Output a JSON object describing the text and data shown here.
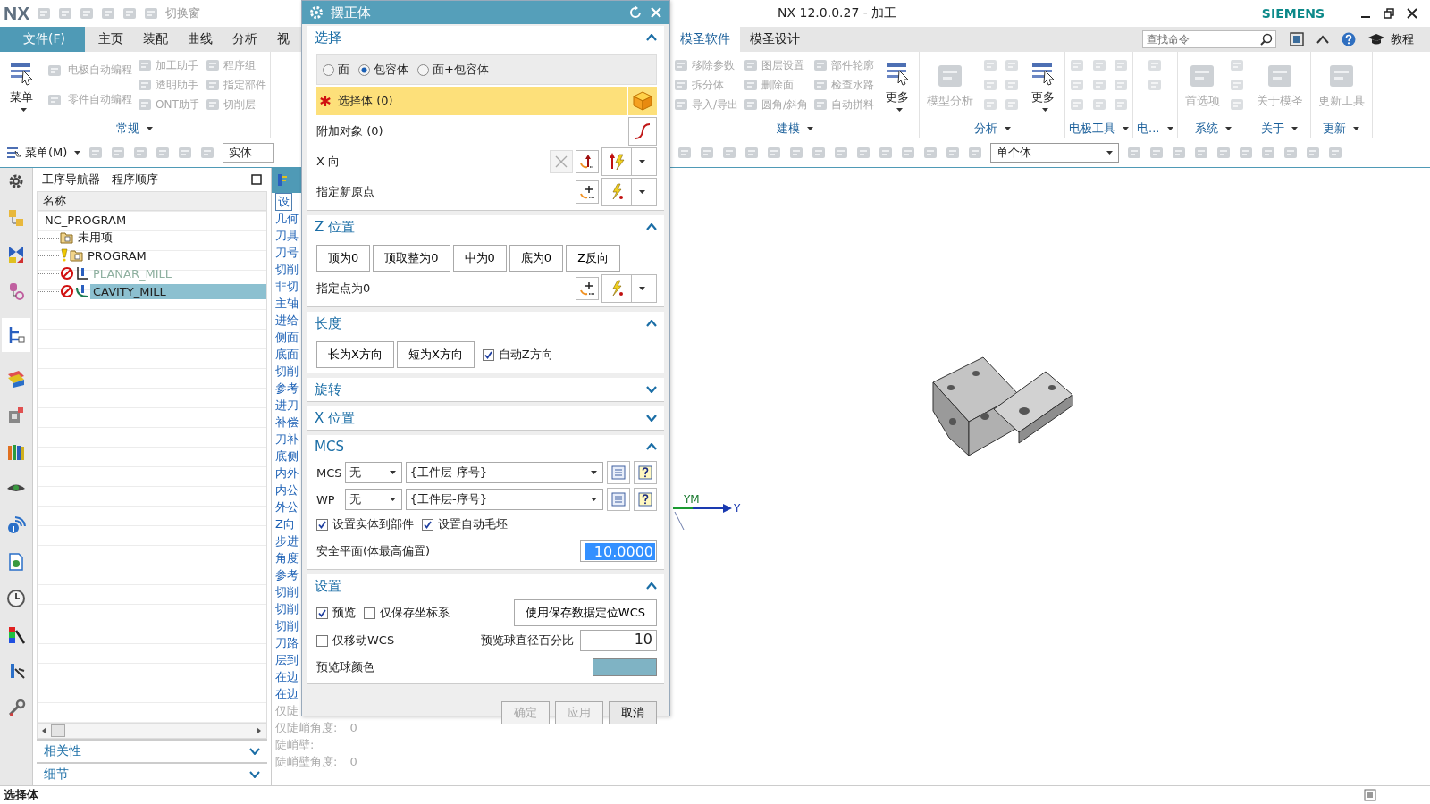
{
  "titlebar": {
    "logo": "NX",
    "switch_window": "切换窗",
    "title": "NX 12.0.0.27 - 加工",
    "brand": "SIEMENS"
  },
  "tabs_left": [
    {
      "label": "文件(F)",
      "kind": "file",
      "selected": false
    },
    {
      "label": "主页",
      "kind": "tab",
      "selected": false
    },
    {
      "label": "装配",
      "kind": "tab",
      "selected": false
    },
    {
      "label": "曲线",
      "kind": "tab",
      "selected": false
    },
    {
      "label": "分析",
      "kind": "tab",
      "selected": false
    },
    {
      "label": "视",
      "kind": "tab",
      "selected": false
    }
  ],
  "tabs_right": [
    {
      "label": "模圣软件",
      "selected": true
    },
    {
      "label": "模圣设计",
      "selected": false
    }
  ],
  "search": {
    "placeholder": "查找命令"
  },
  "help_label": "教程",
  "ribbon_left": [
    {
      "label": "常规",
      "items": [
        {
          "label": "菜单",
          "kind": "large",
          "disabled": false,
          "menu": true
        },
        {
          "label": "电极自动编程",
          "kind": "medium",
          "disabled": true
        },
        {
          "label": "零件自动编程",
          "kind": "medium",
          "disabled": true
        },
        {
          "label": "加工助手",
          "kind": "small",
          "disabled": true
        },
        {
          "label": "透明助手",
          "kind": "small",
          "disabled": true
        },
        {
          "label": "ONT助手",
          "kind": "small",
          "disabled": true
        },
        {
          "label": "程序组",
          "kind": "small",
          "disabled": true
        },
        {
          "label": "指定部件",
          "kind": "small",
          "disabled": true
        },
        {
          "label": "切削层",
          "kind": "small",
          "disabled": true
        }
      ]
    }
  ],
  "ribbon_right": [
    {
      "label": "建模",
      "items": [
        {
          "label": "移除参数",
          "kind": "small",
          "disabled": true
        },
        {
          "label": "拆分体",
          "kind": "small",
          "disabled": true
        },
        {
          "label": "导入/导出",
          "kind": "small",
          "disabled": true
        },
        {
          "label": "图层设置",
          "kind": "small",
          "disabled": true
        },
        {
          "label": "删除面",
          "kind": "small",
          "disabled": true
        },
        {
          "label": "圆角/斜角",
          "kind": "small",
          "disabled": true
        },
        {
          "label": "部件轮廓",
          "kind": "small",
          "disabled": true
        },
        {
          "label": "检查水路",
          "kind": "small",
          "disabled": true
        },
        {
          "label": "自动拼料",
          "kind": "small",
          "disabled": true
        },
        {
          "label": "更多",
          "kind": "large",
          "disabled": false,
          "menu": true
        }
      ]
    },
    {
      "label": "分析",
      "items": [
        {
          "label": "模型分析",
          "kind": "large",
          "disabled": true
        },
        {
          "kind": "icon",
          "disabled": true
        },
        {
          "kind": "icon",
          "disabled": true
        },
        {
          "kind": "icon",
          "disabled": true
        },
        {
          "kind": "icon",
          "disabled": true
        },
        {
          "kind": "icon",
          "disabled": true
        },
        {
          "kind": "icon",
          "disabled": true
        },
        {
          "label": "更多",
          "kind": "large",
          "disabled": false,
          "menu": true
        }
      ]
    },
    {
      "label": "电极工具",
      "items": [
        {
          "kind": "icon",
          "disabled": true
        },
        {
          "kind": "icon",
          "disabled": true
        },
        {
          "kind": "icon",
          "disabled": true
        },
        {
          "kind": "icon",
          "disabled": true
        },
        {
          "kind": "icon",
          "disabled": true
        },
        {
          "kind": "icon",
          "disabled": true
        },
        {
          "kind": "icon",
          "disabled": true
        },
        {
          "kind": "icon",
          "disabled": true
        },
        {
          "kind": "icon",
          "disabled": true
        }
      ]
    },
    {
      "label": "电...",
      "items": [
        {
          "kind": "icon",
          "disabled": true
        },
        {
          "kind": "icon",
          "disabled": true
        }
      ]
    },
    {
      "label": "系统",
      "items": [
        {
          "label": "首选项",
          "kind": "large",
          "disabled": true
        },
        {
          "kind": "icon",
          "disabled": true
        },
        {
          "kind": "icon",
          "disabled": true
        },
        {
          "kind": "icon",
          "disabled": true
        }
      ]
    },
    {
      "label": "关于",
      "items": [
        {
          "label": "关于模圣",
          "kind": "large",
          "disabled": true
        }
      ]
    },
    {
      "label": "更新",
      "items": [
        {
          "label": "更新工具",
          "kind": "large",
          "disabled": true
        }
      ]
    }
  ],
  "toolbar": {
    "menu": "菜单(M)",
    "filter": "实体",
    "scope": "单个体"
  },
  "navigator": {
    "title": "工序导航器 - 程序顺序",
    "column": "名称",
    "tree": [
      {
        "label": "NC_PROGRAM",
        "selected": false,
        "disabled": false,
        "children": [
          {
            "label": "未用项",
            "kind": "folder",
            "warning": false,
            "blocked": false,
            "selected": false,
            "disabled": false
          },
          {
            "label": "PROGRAM",
            "kind": "folder",
            "warning": true,
            "blocked": false,
            "selected": false,
            "disabled": false
          },
          {
            "label": "PLANAR_MILL",
            "kind": "planar",
            "warning": false,
            "blocked": true,
            "selected": false,
            "disabled": true
          },
          {
            "label": "CAVITY_MILL",
            "kind": "cavity",
            "warning": false,
            "blocked": true,
            "selected": true,
            "disabled": false
          }
        ]
      }
    ],
    "panels": [
      {
        "title": "相关性",
        "expanded": false
      },
      {
        "title": "细节",
        "expanded": false
      }
    ]
  },
  "operation_list": [
    {
      "label": "设",
      "kind": "header",
      "disabled": false
    },
    {
      "label": "几何",
      "disabled": false
    },
    {
      "label": "刀具",
      "disabled": false
    },
    {
      "label": "刀号",
      "disabled": false
    },
    {
      "label": "切削",
      "disabled": false
    },
    {
      "label": "非切",
      "disabled": false
    },
    {
      "label": "主轴",
      "disabled": false
    },
    {
      "label": "进给",
      "disabled": false
    },
    {
      "label": "侧面",
      "disabled": false
    },
    {
      "label": "底面",
      "disabled": false
    },
    {
      "label": "切削",
      "disabled": false
    },
    {
      "label": "参考",
      "disabled": false
    },
    {
      "label": "进刀",
      "disabled": false
    },
    {
      "label": "补偿",
      "disabled": false
    },
    {
      "label": "刀补",
      "disabled": false
    },
    {
      "label": "底侧",
      "disabled": false
    },
    {
      "label": "内外",
      "disabled": false
    },
    {
      "label": "内公",
      "disabled": false
    },
    {
      "label": "外公",
      "disabled": false
    },
    {
      "label": "Z向",
      "disabled": false
    },
    {
      "label": "步进",
      "disabled": false
    },
    {
      "label": "角度",
      "disabled": false
    },
    {
      "label": "参考",
      "disabled": false
    },
    {
      "label": "切削",
      "disabled": false
    },
    {
      "label": "切削",
      "disabled": false
    },
    {
      "label": "切削",
      "disabled": false
    },
    {
      "label": "刀路",
      "disabled": false
    },
    {
      "label": "层到",
      "disabled": false
    },
    {
      "label": "在边",
      "disabled": false
    },
    {
      "label": "在边",
      "disabled": false
    },
    {
      "label": "仅陡",
      "disabled": true
    },
    {
      "label": "仅陡峭角度:",
      "value": "0",
      "disabled": true
    },
    {
      "label": "陡峭壁:",
      "disabled": true
    },
    {
      "label": "陡峭壁角度:",
      "value": "0",
      "disabled": true
    }
  ],
  "graphics": {
    "axis_labels": [
      "YM",
      "Y"
    ]
  },
  "dialog": {
    "title": "摆正体",
    "sections": [
      {
        "kind": "selection",
        "title": "选择",
        "expanded": true,
        "radios": [
          {
            "label": "面",
            "selected": false
          },
          {
            "label": "包容体",
            "selected": true
          },
          {
            "label": "面+包容体",
            "selected": false
          }
        ],
        "select_body": "选择体 (0)",
        "additional": "附加对象 (0)",
        "x_direction": "X 向",
        "new_origin": "指定新原点"
      },
      {
        "kind": "z_position",
        "title": "Z 位置",
        "expanded": true,
        "buttons": [
          "顶为0",
          "顶取整为0",
          "中为0",
          "底为0",
          "Z反向"
        ],
        "point": "指定点为0"
      },
      {
        "kind": "length",
        "title": "长度",
        "expanded": true,
        "buttons": [
          "长为X方向",
          "短为X方向"
        ],
        "checkbox": {
          "label": "自动Z方向",
          "checked": true
        }
      },
      {
        "title": "旋转",
        "expanded": false
      },
      {
        "title": "X 位置",
        "expanded": false
      },
      {
        "kind": "mcs",
        "title": "MCS",
        "expanded": true,
        "rows": [
          {
            "label": "MCS",
            "mode": "无",
            "template": "{工件层-序号}"
          },
          {
            "label": "WP",
            "mode": "无",
            "template": "{工件层-序号}"
          }
        ],
        "checkboxes": [
          {
            "label": "设置实体到部件",
            "checked": true
          },
          {
            "label": "设置自动毛坯",
            "checked": true
          }
        ],
        "safe_plane": {
          "label": "安全平面(体最高偏置)",
          "value": "10.0000"
        }
      },
      {
        "kind": "settings",
        "title": "设置",
        "expanded": true,
        "checkboxes": [
          {
            "label": "预览",
            "checked": true
          },
          {
            "label": "仅保存坐标系",
            "checked": false
          },
          {
            "label": "仅移动WCS",
            "checked": false
          }
        ],
        "button": "使用保存数据定位WCS",
        "diameter": {
          "label": "预览球直径百分比",
          "value": "10"
        },
        "color_label": "预览球颜色"
      }
    ],
    "footer": [
      {
        "label": "确定",
        "disabled": true
      },
      {
        "label": "应用",
        "disabled": true
      },
      {
        "label": "取消",
        "disabled": false
      }
    ]
  },
  "status_bar": {
    "text": "选择体"
  }
}
